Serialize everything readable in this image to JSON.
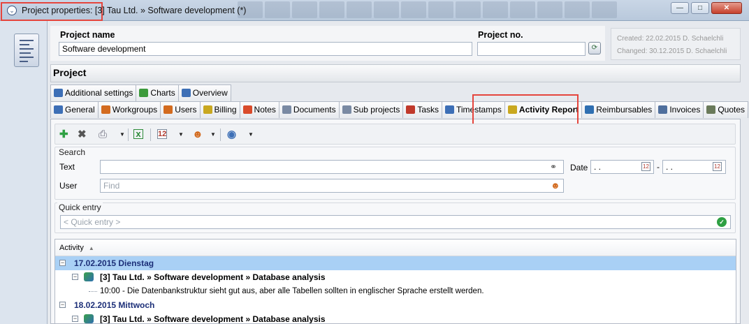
{
  "window": {
    "title": "Project properties: [3] Tau Ltd. » Software development (*)",
    "title_icon": "chevron-circle-icon",
    "controls": {
      "minimize": "—",
      "maximize": "□",
      "close": "✕"
    }
  },
  "header": {
    "project_name_label": "Project name",
    "project_name_value": "Software development",
    "project_no_label": "Project no.",
    "project_no_value": "",
    "meta_created": "Created: 22.02.2015  D. Schaelchli",
    "meta_changed": "Changed: 30.12.2015  D. Schaelchli"
  },
  "section_title": "Project",
  "tabs_top": [
    {
      "label": "Additional settings",
      "icon": "info-icon",
      "color": "#3d6fb6"
    },
    {
      "label": "Charts",
      "icon": "chart-icon",
      "color": "#3c9a3c"
    },
    {
      "label": "Overview",
      "icon": "eye-icon",
      "color": "#3d6fb6"
    }
  ],
  "tabs_bottom": [
    {
      "label": "General",
      "icon": "info-icon",
      "color": "#3d6fb6"
    },
    {
      "label": "Workgroups",
      "icon": "group-icon",
      "color": "#d36b1f"
    },
    {
      "label": "Users",
      "icon": "users-icon",
      "color": "#d36b1f"
    },
    {
      "label": "Billing",
      "icon": "billing-icon",
      "color": "#c9a820"
    },
    {
      "label": "Notes",
      "icon": "notes-icon",
      "color": "#d94b2b"
    },
    {
      "label": "Documents",
      "icon": "documents-icon",
      "color": "#7a8aa3"
    },
    {
      "label": "Sub projects",
      "icon": "subproject-icon",
      "color": "#7a8aa3"
    },
    {
      "label": "Tasks",
      "icon": "tasks-icon",
      "color": "#c0392b"
    },
    {
      "label": "Timestamps",
      "icon": "clock-icon",
      "color": "#3d6fb6"
    },
    {
      "label": "Activity Report",
      "icon": "activity-icon",
      "color": "#c9a820"
    },
    {
      "label": "Reimbursables",
      "icon": "reimbursables-icon",
      "color": "#2f6fb1"
    },
    {
      "label": "Invoices",
      "icon": "invoices-icon",
      "color": "#4f6f9d"
    },
    {
      "label": "Quotes",
      "icon": "quotes-icon",
      "color": "#6a7a5a"
    }
  ],
  "active_tab": "Activity Report",
  "search": {
    "group_label": "Search",
    "text_label": "Text",
    "text_value": "",
    "user_label": "User",
    "user_placeholder": "Find",
    "date_label": "Date",
    "date_from": ". .",
    "date_to": ". .",
    "date_sep": "-"
  },
  "quick_entry": {
    "group_label": "Quick entry",
    "placeholder": "< Quick entry >"
  },
  "activity_list": {
    "column_header": "Activity",
    "rows": [
      {
        "type": "day",
        "text": "17.02.2015 Dienstag",
        "selected": true
      },
      {
        "type": "entry",
        "text": "[3] Tau Ltd. » Software development » Database analysis"
      },
      {
        "type": "note",
        "text": "10:00 - Die Datenbankstruktur sieht gut aus, aber alle Tabellen sollten in englischer Sprache erstellt werden."
      },
      {
        "type": "day",
        "text": "18.02.2015 Mittwoch",
        "selected": false
      },
      {
        "type": "entry",
        "text": "[3] Tau Ltd. » Software development » Database analysis"
      }
    ]
  },
  "colors": {
    "highlight": "#e5453d",
    "selected_row": "#a9d0f5",
    "day_text": "#1c2f78",
    "accept_green": "#2ea043"
  }
}
